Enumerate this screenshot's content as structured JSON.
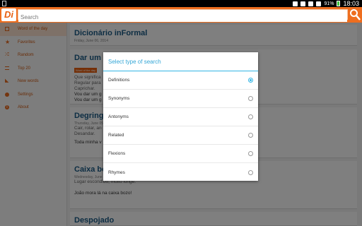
{
  "status_bar": {
    "battery": "91%",
    "time": "18:03"
  },
  "app": {
    "logo_text": "Di"
  },
  "search": {
    "placeholder": "Search"
  },
  "sidebar": {
    "items": [
      {
        "label": "Word of the day",
        "icon": "calendar-icon"
      },
      {
        "label": "Favorites",
        "icon": "star-icon"
      },
      {
        "label": "Random",
        "icon": "shuffle-icon"
      },
      {
        "label": "Top 20",
        "icon": "list-icon"
      },
      {
        "label": "New words",
        "icon": "rss-icon"
      },
      {
        "label": "Settings",
        "icon": "gear-icon"
      },
      {
        "label": "About",
        "icon": "info-icon"
      }
    ]
  },
  "content": {
    "header": {
      "title": "Dicionário inFormal",
      "date": "Friday, June 06, 2014"
    },
    "cards": [
      {
        "title": "Dar um",
        "tag": "Word of the day",
        "lines": [
          "Que significa",
          "Regular para",
          "Caprichar."
        ],
        "examples": [
          "Vou dar um g",
          "Vou dar um g"
        ]
      },
      {
        "title": "Degring",
        "date": "Thursday, June 05, 2014",
        "lines": [
          "Cair, rolar, an",
          "Desandar."
        ],
        "examples": [
          "Toda minha v"
        ]
      },
      {
        "title": "Caixa bo",
        "date": "Wednesday, June 04, 2014",
        "lines": [
          "Lugar escondido, muito longe."
        ],
        "examples": [
          "João mora lá na caixa bozo!"
        ]
      },
      {
        "title": "Despojado"
      }
    ]
  },
  "dialog": {
    "title": "Select type of search",
    "options": [
      {
        "label": "Definitions",
        "selected": true
      },
      {
        "label": "Synonyms",
        "selected": false
      },
      {
        "label": "Antonyms",
        "selected": false
      },
      {
        "label": "Related",
        "selected": false
      },
      {
        "label": "Flexions",
        "selected": false
      },
      {
        "label": "Rhymes",
        "selected": false
      }
    ]
  },
  "colors": {
    "accent": "#ee6e1f",
    "dialog_accent": "#33b5e5",
    "link_title": "#1a5b86"
  }
}
